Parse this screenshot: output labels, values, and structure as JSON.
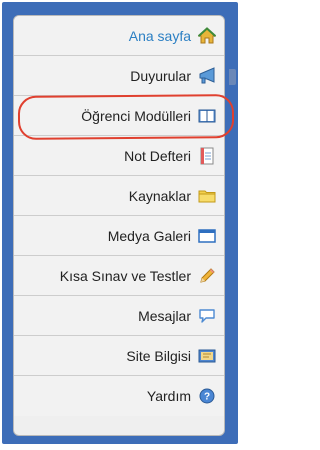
{
  "sidebar": {
    "items": [
      {
        "label": "Ana sayfa",
        "icon": "home-icon"
      },
      {
        "label": "Duyurular",
        "icon": "megaphone-icon"
      },
      {
        "label": "Öğrenci Modülleri",
        "icon": "book-icon"
      },
      {
        "label": "Not Defteri",
        "icon": "notepad-icon"
      },
      {
        "label": "Kaynaklar",
        "icon": "folder-icon"
      },
      {
        "label": "Medya Galeri",
        "icon": "window-icon"
      },
      {
        "label": "Kısa Sınav ve Testler",
        "icon": "pencil-icon"
      },
      {
        "label": "Mesajlar",
        "icon": "chat-bubble-icon"
      },
      {
        "label": "Site Bilgisi",
        "icon": "info-card-icon"
      },
      {
        "label": "Yardım",
        "icon": "help-icon"
      }
    ]
  },
  "colors": {
    "frame": "#3d6db8",
    "active_link": "#2b7fc3",
    "highlight_circle": "#e0402f"
  }
}
